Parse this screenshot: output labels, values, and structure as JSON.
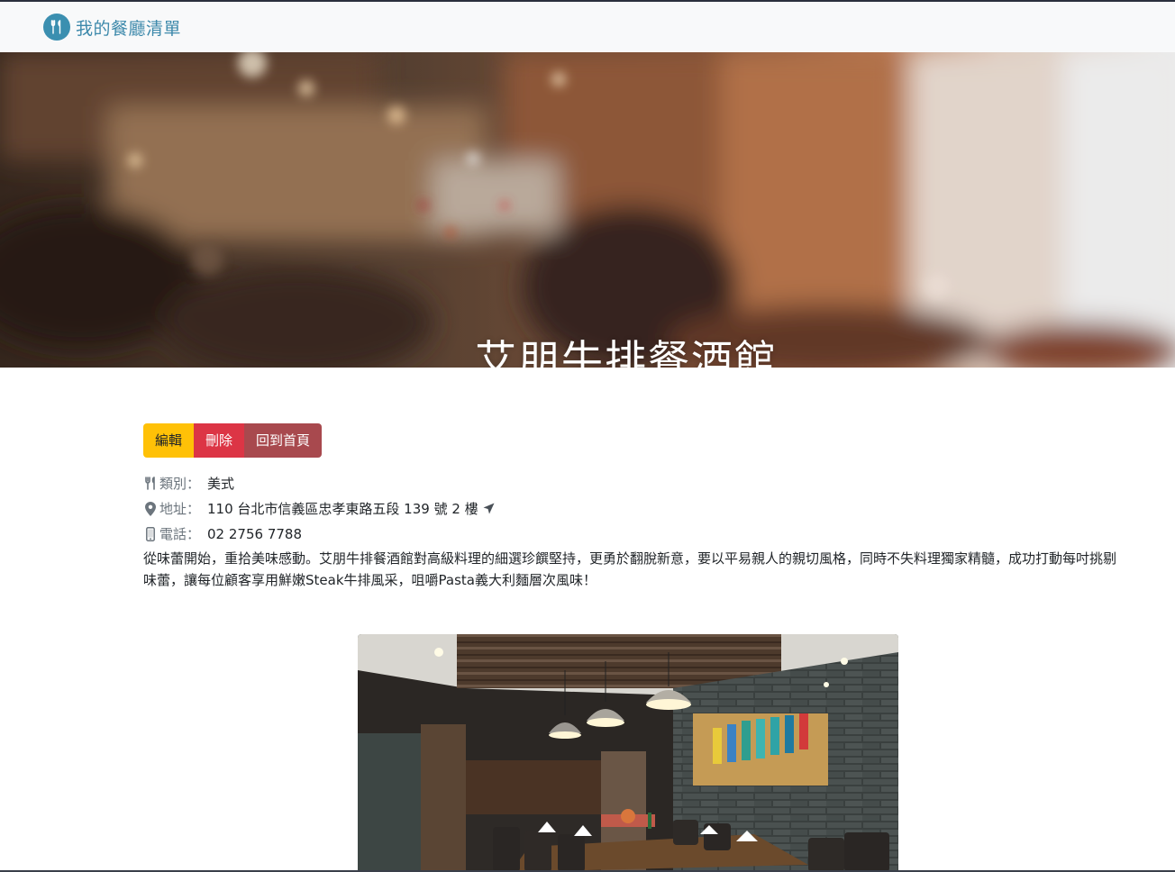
{
  "navbar": {
    "brand_text": "我的餐廳清單",
    "brand_icon": "utensils-icon",
    "brand_color": "#3b8fb0"
  },
  "banner": {
    "title": "艾朋牛排餐酒館"
  },
  "actions": {
    "edit_label": "編輯",
    "delete_label": "刪除",
    "home_label": "回到首頁",
    "edit_color": "#ffc107",
    "delete_color": "#dc3545",
    "home_color": "#a8494e"
  },
  "details": {
    "category_label": "類別：",
    "category_value": "美式",
    "category_icon": "utensils-icon",
    "address_label": "地址：",
    "address_value": "110 台北市信義區忠孝東路五段 139 號 2 樓",
    "address_icon": "map-marker-icon",
    "address_link_icon": "location-arrow-icon",
    "phone_label": "電話：",
    "phone_value": "02 2756 7788",
    "phone_icon": "mobile-phone-icon"
  },
  "description": "從味蕾開始，重拾美味感動。艾朋牛排餐酒館對高級料理的細選珍饌堅持，更勇於翻脫新意，要以平易親人的親切風格，同時不失料理獨家精髓，成功打動每吋挑剔味蕾，讓每位顧客享用鮮嫩Steak牛排風采，咀嚼Pasta義大利麵層次風味！"
}
